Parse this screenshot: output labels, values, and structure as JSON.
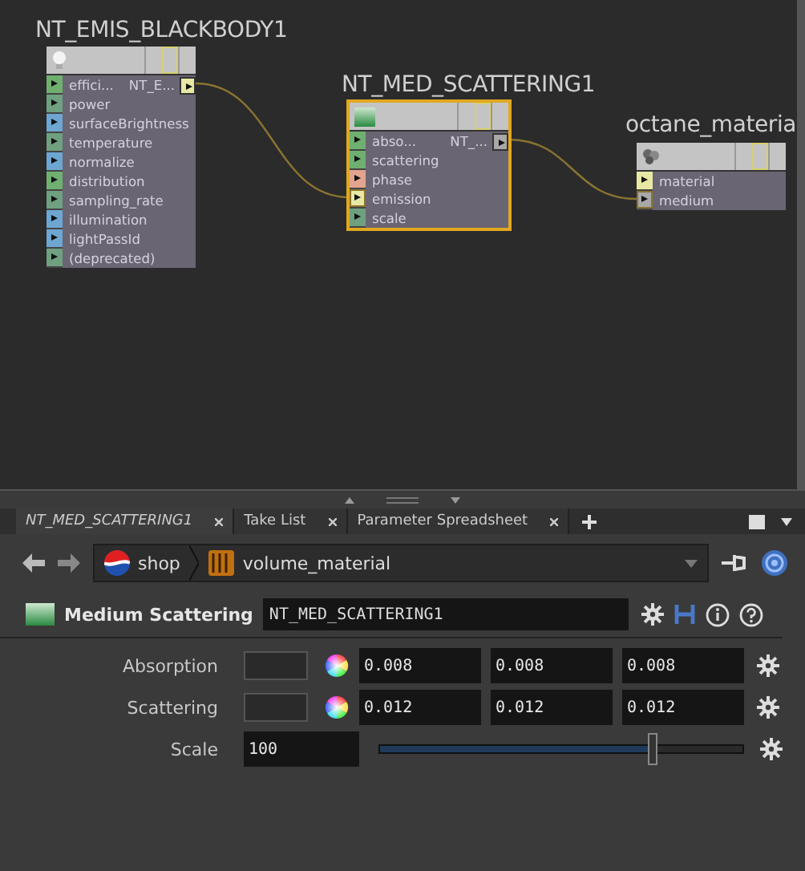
{
  "network": {
    "nodes": [
      {
        "title": "NT_EMIS_BLACKBODY1",
        "selected": false,
        "output": {
          "label": "NT_E..."
        },
        "ports": [
          {
            "label": "effici...",
            "color": "#6fb070",
            "connected": false
          },
          {
            "label": "power",
            "color": "#6fa080",
            "connected": false
          },
          {
            "label": "surfaceBrightness",
            "color": "#6ea6d2",
            "connected": false
          },
          {
            "label": "temperature",
            "color": "#6fa080",
            "connected": false
          },
          {
            "label": "normalize",
            "color": "#6ea6d2",
            "connected": false
          },
          {
            "label": "distribution",
            "color": "#6fb070",
            "connected": false
          },
          {
            "label": "sampling_rate",
            "color": "#6fa080",
            "connected": false
          },
          {
            "label": "illumination",
            "color": "#6ea6d2",
            "connected": false
          },
          {
            "label": "lightPassId",
            "color": "#6ea6d2",
            "connected": false
          },
          {
            "label": "(deprecated)",
            "color": "#6fa080",
            "connected": false
          }
        ]
      },
      {
        "title": "NT_MED_SCATTERING1",
        "selected": true,
        "output": {
          "label": "NT_..."
        },
        "ports": [
          {
            "label": "abso...",
            "color": "#6fb070",
            "connected": false
          },
          {
            "label": "scattering",
            "color": "#6fb070",
            "connected": false
          },
          {
            "label": "phase",
            "color": "#e2a48e",
            "connected": false
          },
          {
            "label": "emission",
            "color": "#e8e8a4",
            "connected": true
          },
          {
            "label": "scale",
            "color": "#6fa080",
            "connected": false
          }
        ]
      },
      {
        "title": "octane_materia",
        "selected": false,
        "ports": [
          {
            "label": "material",
            "color": "#e8e8a4",
            "connected": false
          },
          {
            "label": "medium",
            "color": "#a8a8a8",
            "connected": true
          }
        ]
      }
    ]
  },
  "tabs": [
    {
      "label": "NT_MED_SCATTERING1",
      "selected": true
    },
    {
      "label": "Take List",
      "selected": false
    },
    {
      "label": "Parameter Spreadsheet",
      "selected": false
    }
  ],
  "path": [
    "shop",
    "volume_material"
  ],
  "header": {
    "type_label": "Medium Scattering",
    "name": "NT_MED_SCATTERING1"
  },
  "parameters": [
    {
      "kind": "color",
      "label": "Absorption",
      "values": [
        "0.008",
        "0.008",
        "0.008"
      ]
    },
    {
      "kind": "color",
      "label": "Scattering",
      "values": [
        "0.012",
        "0.012",
        "0.012"
      ]
    },
    {
      "kind": "slider",
      "label": "Scale",
      "value": "100",
      "level": 0.75
    }
  ]
}
